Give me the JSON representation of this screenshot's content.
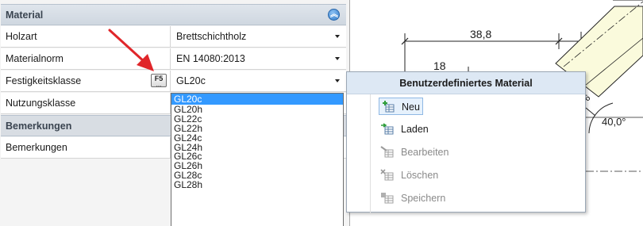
{
  "panel": {
    "sections": {
      "material": "Material",
      "bemerkungen": "Bemerkungen"
    },
    "rows": {
      "holzart": {
        "label": "Holzart",
        "value": "Brettschichtholz"
      },
      "materialnorm": {
        "label": "Materialnorm",
        "value": "EN 14080:2013"
      },
      "festigkeitsklasse": {
        "label": "Festigkeitsklasse",
        "value": "GL20c"
      },
      "nutzungsklasse": {
        "label": "Nutzungsklasse",
        "value": ""
      },
      "bemerkungen": {
        "label": "Bemerkungen",
        "value": ""
      }
    },
    "f5_key": {
      "top": "F5",
      "bottom": "..."
    }
  },
  "dropdown": {
    "options": [
      "GL20c",
      "GL20h",
      "GL22c",
      "GL22h",
      "GL24c",
      "GL24h",
      "GL26c",
      "GL26h",
      "GL28c",
      "GL28h"
    ],
    "selected": "GL20c"
  },
  "menu": {
    "title": "Benutzerdefiniertes Material",
    "items": {
      "neu": "Neu",
      "laden": "Laden",
      "bearbeiten": "Bearbeiten",
      "loeschen": "Löschen",
      "speichern": "Speichern"
    }
  },
  "drawing": {
    "dim_top": "38,8",
    "dim_inner": "18",
    "angle": "40,0°",
    "small_label": "6"
  },
  "colors": {
    "accent_selection": "#3399ff",
    "arrow": "#e0262a",
    "menu_header": "#dde8f4",
    "section_header": "#d3dae2",
    "beam_fill": "#fafadc"
  },
  "icons": {
    "collapse": "double-chevron-up-icon",
    "neu": "add-table-icon",
    "laden": "load-table-icon",
    "bearbeiten": "edit-table-icon",
    "loeschen": "delete-table-icon",
    "speichern": "save-table-icon"
  }
}
